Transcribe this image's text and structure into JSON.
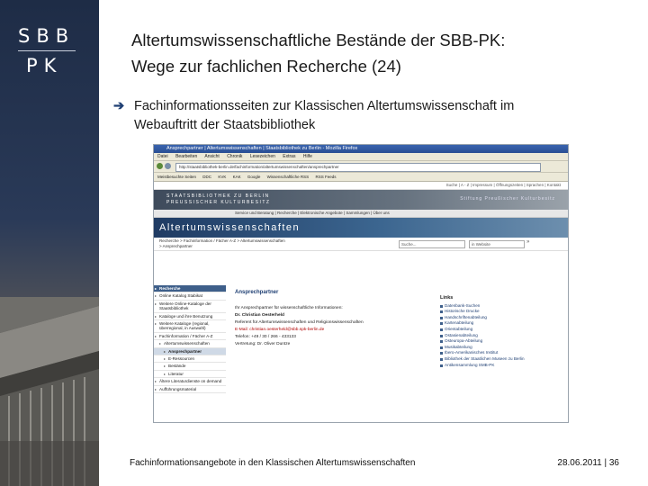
{
  "logo": {
    "line1": "SBB",
    "line2": "PK"
  },
  "slide": {
    "title_line1": "Altertumswissenschaftliche Bestände der SBB-PK:",
    "title_line2": "Wege zur fachlichen Recherche (24)",
    "bullet_icon": "arrow-bullet-icon",
    "bullet_line1": "Fachinformationsseiten zur Klassischen Altertumswissenschaft im",
    "bullet_line2": "Webauftritt der Staatsbibliothek"
  },
  "screenshot": {
    "window_title": "Ansprechpartner | Altertumswissenschaften | Staatsbibliothek zu Berlin - Mozilla Firefox",
    "menu": [
      "Datei",
      "Bearbeiten",
      "Ansicht",
      "Chronik",
      "Lesezeichen",
      "Extras",
      "Hilfe"
    ],
    "address": "http://staatsbibliothek-berlin.de/fachinformation/altertumswissenschaften/ansprechpartner",
    "bookmarks": [
      "Meistbesuchte Seiten",
      "DDC",
      "KVK",
      "KAK",
      "Google",
      "Wissenschaftliche RSS",
      "RSS Feeds"
    ],
    "toplinks": "Suche | A - Z | Impressum | Öffnungszeiten | Sprachen | Kontakt",
    "org": "STAATSBIBLIOTHEK ZU BERLIN",
    "org_sub": "PREUSSISCHER KULTURBESITZ",
    "org_right": "Stiftung Preußischer Kulturbesitz",
    "navbar": "Service und Beratung | Recherche | Elektronische Angebote | Sammlungen | Über uns",
    "section_heading": "Altertumswissenschaften",
    "breadcrumb1": "Recherche > Fachinformation / Fächer A-Z > Altertumswissenschaften",
    "breadcrumb2": "> Ansprechpartner",
    "search_placeholder": "Suche...",
    "search_scope": "in Website",
    "search_go": "»",
    "left_nav": [
      {
        "label": "Recherche",
        "level": "head"
      },
      {
        "label": "Online Katalog Stabikat",
        "level": "top"
      },
      {
        "label": "Weitere Online-Kataloge der Staatsbibliothek",
        "level": "top"
      },
      {
        "label": "Kataloge und ihre Benutzung",
        "level": "top"
      },
      {
        "label": "Weitere Kataloge (regional, überregional, in Auswahl)",
        "level": "top"
      },
      {
        "label": "Fachinformation / Fächer A-Z",
        "level": "top"
      },
      {
        "label": "Altertumswissenschaften",
        "level": "sub"
      },
      {
        "label": "Ansprechpartner",
        "level": "active"
      },
      {
        "label": "E-Ressourcen",
        "level": "subsub"
      },
      {
        "label": "Bestände",
        "level": "subsub"
      },
      {
        "label": "Literatur",
        "level": "subsub"
      },
      {
        "label": "Ältere Literaturdienste on demand",
        "level": "top"
      },
      {
        "label": "Aufführungsmaterial",
        "level": "top"
      }
    ],
    "content_heading": "Ansprechpartner",
    "content_lines": [
      "Ihr Ansprechpartner für wissenschaftliche Informationen:",
      "Dr. Christian Oesterheld",
      "Referent für Altertumswissenschaften und Religionswissenschaften",
      "E-Mail: christian.oesterheld@sbb.spk-berlin.de",
      "Telefon: +49 / 30 / 266 - 433133",
      "Vertretung: Dr. Oliver Duntze"
    ],
    "links_heading": "Links",
    "links": [
      "Datenbank-Suchen",
      "Historische Drucke",
      "Handschriftenabteilung",
      "Kartenabteilung",
      "Orientabteilung",
      "Ostasienabteilung",
      "Osteuropa-Abteilung",
      "Musikabteilung",
      "Ibero-Amerikanisches Institut",
      "Bibliothek der Staatlichen Museen zu Berlin",
      "Antikensammlung SMB-PK"
    ]
  },
  "footer": {
    "left": "Fachinformationsangebote in den Klassischen Altertumswissenschaften",
    "right": "28.06.2011 | 36"
  }
}
